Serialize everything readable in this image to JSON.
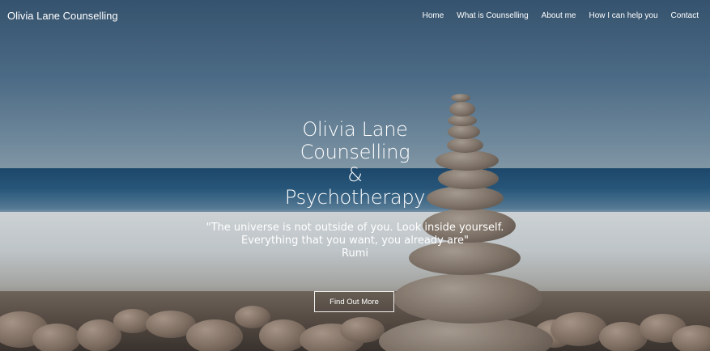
{
  "header": {
    "brand": "Olivia Lane Counselling",
    "nav": [
      {
        "label": "Home"
      },
      {
        "label": "What is Counselling"
      },
      {
        "label": "About me"
      },
      {
        "label": "How I can help you"
      },
      {
        "label": "Contact"
      }
    ]
  },
  "hero": {
    "title_lines": [
      "Olivia Lane",
      "Counselling",
      "&",
      "Psychotherapy"
    ],
    "quote_lines": [
      "\"The universe is not outside of you. Look inside yourself.",
      "Everything that you want, you already are\"",
      "Rumi"
    ],
    "button_label": "Find Out More",
    "background_image": "balanced-stones-on-beach"
  },
  "colors": {
    "text": "#ffffff",
    "sky": "#4a6a86",
    "sea": "#1f4d74"
  }
}
